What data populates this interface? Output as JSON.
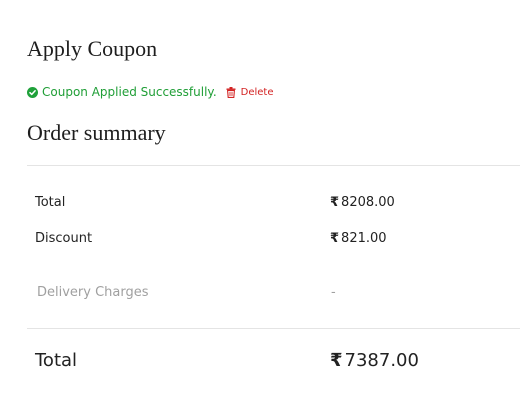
{
  "apply_coupon": {
    "title": "Apply Coupon",
    "status_message": "Coupon Applied Successfully.",
    "delete_label": "Delete"
  },
  "order_summary": {
    "title": "Order summary",
    "currency_symbol": "₹",
    "rows": [
      {
        "label": "Total",
        "value": "8208.00"
      },
      {
        "label": "Discount",
        "value": "821.00"
      },
      {
        "label": "Delivery Charges",
        "value": "-"
      }
    ],
    "grand_total": {
      "label": "Total",
      "value": "7387.00"
    }
  },
  "colors": {
    "success": "#1f9e36",
    "danger": "#d32222",
    "muted": "#a0a0a0",
    "divider": "#e4e4e4"
  },
  "icons": {
    "success": "check-circle-icon",
    "delete": "trash-icon"
  }
}
